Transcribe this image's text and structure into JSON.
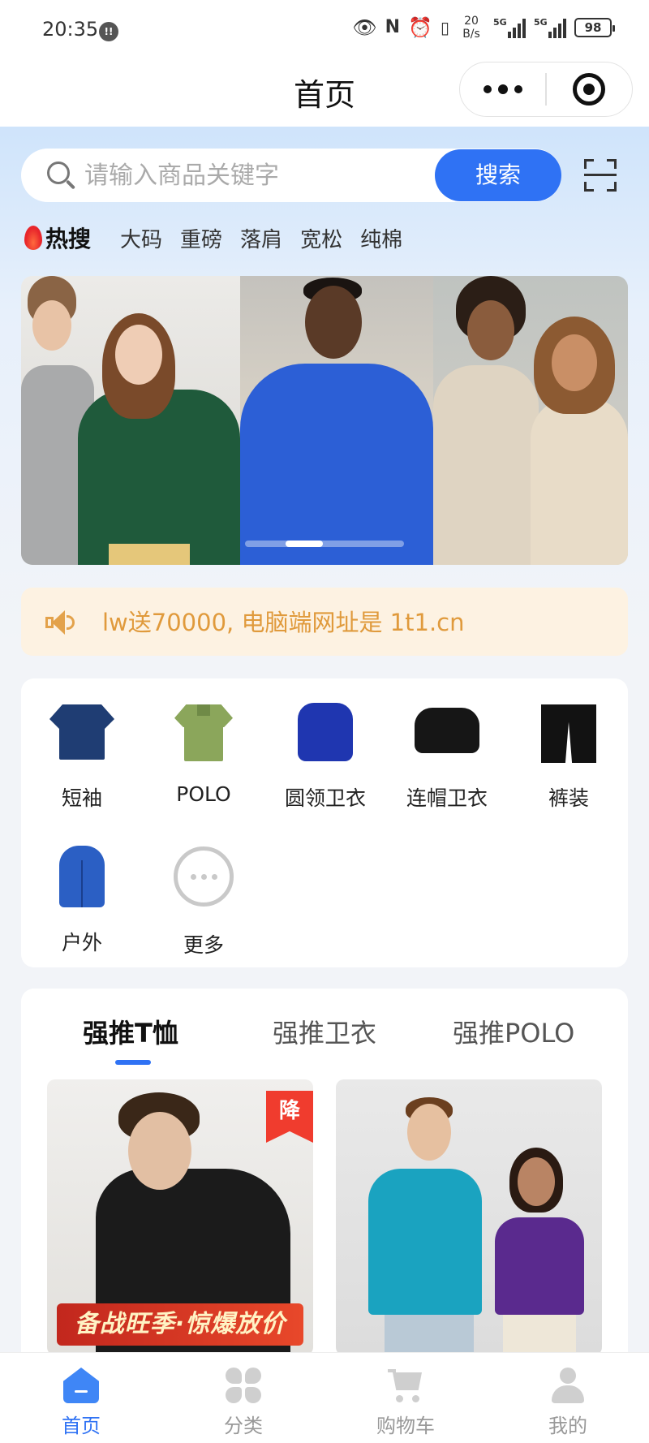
{
  "status_bar": {
    "time": "20:35",
    "notification_badge": "!!",
    "net_speed": "20 B/s",
    "sig1_label": "5G",
    "sig2_label": "5G",
    "battery": "98"
  },
  "nav": {
    "title": "首页"
  },
  "search": {
    "placeholder": "请输入商品关键字",
    "button_label": "搜索"
  },
  "hot_search": {
    "title": "热搜",
    "tags": [
      "大码",
      "重磅",
      "落肩",
      "宽松",
      "纯棉"
    ]
  },
  "banner": {
    "slide_count": 3,
    "active_slide": 1
  },
  "notice": {
    "text": "lw送70000, 电脑端网址是 1t1.cn"
  },
  "categories": [
    {
      "label": "短袖",
      "icon": "navy-tshirt"
    },
    {
      "label": "POLO",
      "icon": "green-polo"
    },
    {
      "label": "圆领卫衣",
      "icon": "blue-sweatshirt"
    },
    {
      "label": "连帽卫衣",
      "icon": "black-hoodie"
    },
    {
      "label": "裤装",
      "icon": "black-shorts"
    },
    {
      "label": "户外",
      "icon": "blue-jacket"
    },
    {
      "label": "更多",
      "icon": "more-dots"
    }
  ],
  "recommend": {
    "tabs": [
      "强推T恤",
      "强推卫衣",
      "强推POLO"
    ],
    "active_tab": 0,
    "products": [
      {
        "badge": "降",
        "promo_text": "备战旺季·惊爆放价"
      },
      {
        "badge": "",
        "promo_text": ""
      }
    ]
  },
  "tabbar": {
    "items": [
      {
        "label": "首页",
        "icon": "home-icon"
      },
      {
        "label": "分类",
        "icon": "category-icon"
      },
      {
        "label": "购物车",
        "icon": "cart-icon"
      },
      {
        "label": "我的",
        "icon": "profile-icon"
      }
    ],
    "active": 0
  },
  "colors": {
    "accent": "#2f72f4",
    "notice_text": "#e09a3c",
    "notice_bg": "#fdf2e2",
    "hot": "#e8262b"
  }
}
